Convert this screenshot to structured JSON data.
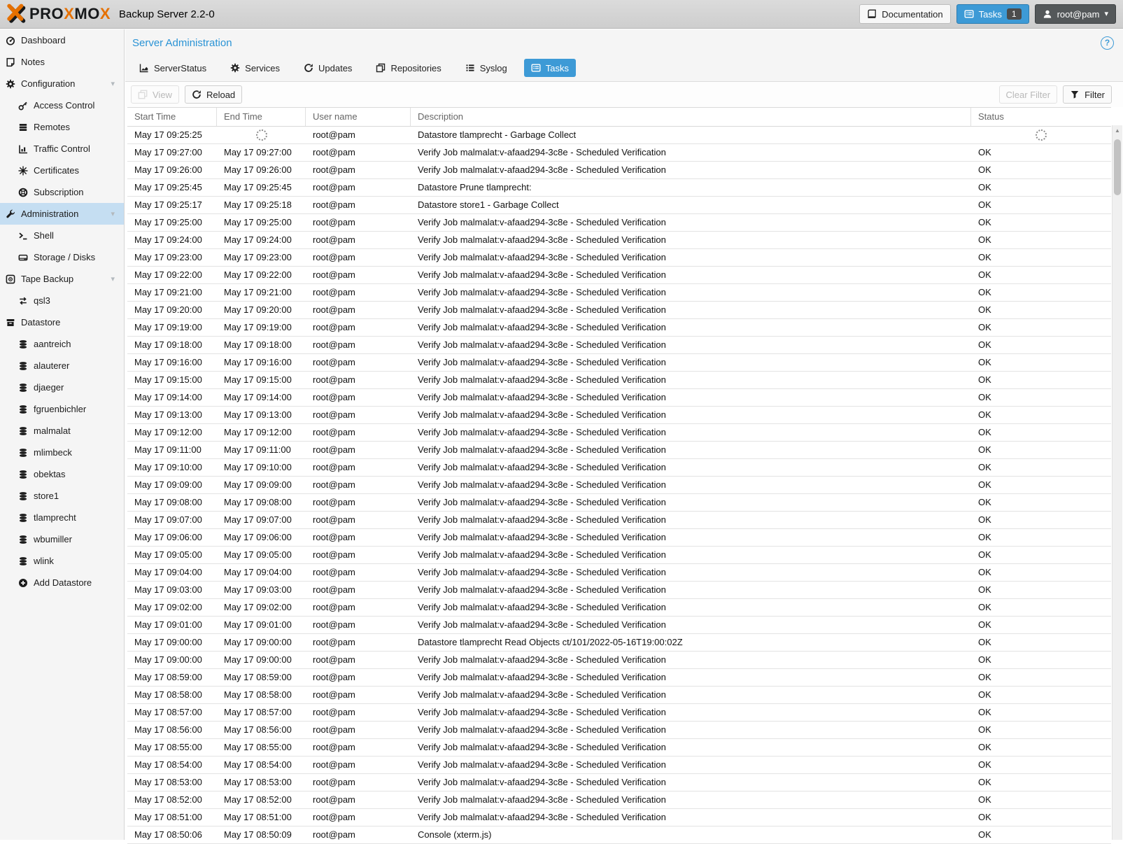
{
  "icons": {
    "caret_down": "▾",
    "help": "?",
    "scroll_up": "▲"
  },
  "topbar": {
    "logo_parts": {
      "p1": "PRO",
      "x1": "X",
      "p2": "MO",
      "x2": "X"
    },
    "product": "Backup Server 2.2-0",
    "documentation_label": "Documentation",
    "tasks_label": "Tasks",
    "tasks_badge": "1",
    "user_label": "root@pam"
  },
  "sidebar": {
    "items": [
      {
        "label": "Dashboard",
        "level": 0
      },
      {
        "label": "Notes",
        "level": 0
      },
      {
        "label": "Configuration",
        "level": 0,
        "caret": true
      },
      {
        "label": "Access Control",
        "level": 1
      },
      {
        "label": "Remotes",
        "level": 1
      },
      {
        "label": "Traffic Control",
        "level": 1
      },
      {
        "label": "Certificates",
        "level": 1
      },
      {
        "label": "Subscription",
        "level": 1
      },
      {
        "label": "Administration",
        "level": 0,
        "caret": true,
        "selected": true
      },
      {
        "label": "Shell",
        "level": 1
      },
      {
        "label": "Storage / Disks",
        "level": 1
      },
      {
        "label": "Tape Backup",
        "level": 0,
        "caret": true
      },
      {
        "label": "qsl3",
        "level": 1
      },
      {
        "label": "Datastore",
        "level": 0
      },
      {
        "label": "aantreich",
        "level": 1
      },
      {
        "label": "alauterer",
        "level": 1
      },
      {
        "label": "djaeger",
        "level": 1
      },
      {
        "label": "fgruenbichler",
        "level": 1
      },
      {
        "label": "malmalat",
        "level": 1
      },
      {
        "label": "mlimbeck",
        "level": 1
      },
      {
        "label": "obektas",
        "level": 1
      },
      {
        "label": "store1",
        "level": 1
      },
      {
        "label": "tlamprecht",
        "level": 1
      },
      {
        "label": "wbumiller",
        "level": 1
      },
      {
        "label": "wlink",
        "level": 1
      },
      {
        "label": "Add Datastore",
        "level": 1
      }
    ]
  },
  "content": {
    "title": "Server Administration",
    "tabs": [
      {
        "label": "ServerStatus"
      },
      {
        "label": "Services"
      },
      {
        "label": "Updates"
      },
      {
        "label": "Repositories"
      },
      {
        "label": "Syslog"
      },
      {
        "label": "Tasks",
        "active": true
      }
    ],
    "toolbar": {
      "view_label": "View",
      "reload_label": "Reload",
      "clear_filter_label": "Clear Filter",
      "filter_label": "Filter"
    },
    "table": {
      "columns": {
        "start": "Start Time",
        "end": "End Time",
        "user": "User name",
        "desc": "Description",
        "status": "Status"
      },
      "rows": [
        {
          "start": "May 17 09:25:25",
          "end": "",
          "user": "root@pam",
          "desc": "Datastore tlamprecht - Garbage Collect",
          "status": "",
          "loading": true
        },
        {
          "start": "May 17 09:27:00",
          "end": "May 17 09:27:00",
          "user": "root@pam",
          "desc": "Verify Job malmalat:v-afaad294-3c8e - Scheduled Verification",
          "status": "OK"
        },
        {
          "start": "May 17 09:26:00",
          "end": "May 17 09:26:00",
          "user": "root@pam",
          "desc": "Verify Job malmalat:v-afaad294-3c8e - Scheduled Verification",
          "status": "OK"
        },
        {
          "start": "May 17 09:25:45",
          "end": "May 17 09:25:45",
          "user": "root@pam",
          "desc": "Datastore Prune tlamprecht:",
          "status": "OK"
        },
        {
          "start": "May 17 09:25:17",
          "end": "May 17 09:25:18",
          "user": "root@pam",
          "desc": "Datastore store1 - Garbage Collect",
          "status": "OK"
        },
        {
          "start": "May 17 09:25:00",
          "end": "May 17 09:25:00",
          "user": "root@pam",
          "desc": "Verify Job malmalat:v-afaad294-3c8e - Scheduled Verification",
          "status": "OK"
        },
        {
          "start": "May 17 09:24:00",
          "end": "May 17 09:24:00",
          "user": "root@pam",
          "desc": "Verify Job malmalat:v-afaad294-3c8e - Scheduled Verification",
          "status": "OK"
        },
        {
          "start": "May 17 09:23:00",
          "end": "May 17 09:23:00",
          "user": "root@pam",
          "desc": "Verify Job malmalat:v-afaad294-3c8e - Scheduled Verification",
          "status": "OK"
        },
        {
          "start": "May 17 09:22:00",
          "end": "May 17 09:22:00",
          "user": "root@pam",
          "desc": "Verify Job malmalat:v-afaad294-3c8e - Scheduled Verification",
          "status": "OK"
        },
        {
          "start": "May 17 09:21:00",
          "end": "May 17 09:21:00",
          "user": "root@pam",
          "desc": "Verify Job malmalat:v-afaad294-3c8e - Scheduled Verification",
          "status": "OK"
        },
        {
          "start": "May 17 09:20:00",
          "end": "May 17 09:20:00",
          "user": "root@pam",
          "desc": "Verify Job malmalat:v-afaad294-3c8e - Scheduled Verification",
          "status": "OK"
        },
        {
          "start": "May 17 09:19:00",
          "end": "May 17 09:19:00",
          "user": "root@pam",
          "desc": "Verify Job malmalat:v-afaad294-3c8e - Scheduled Verification",
          "status": "OK"
        },
        {
          "start": "May 17 09:18:00",
          "end": "May 17 09:18:00",
          "user": "root@pam",
          "desc": "Verify Job malmalat:v-afaad294-3c8e - Scheduled Verification",
          "status": "OK"
        },
        {
          "start": "May 17 09:16:00",
          "end": "May 17 09:16:00",
          "user": "root@pam",
          "desc": "Verify Job malmalat:v-afaad294-3c8e - Scheduled Verification",
          "status": "OK"
        },
        {
          "start": "May 17 09:15:00",
          "end": "May 17 09:15:00",
          "user": "root@pam",
          "desc": "Verify Job malmalat:v-afaad294-3c8e - Scheduled Verification",
          "status": "OK"
        },
        {
          "start": "May 17 09:14:00",
          "end": "May 17 09:14:00",
          "user": "root@pam",
          "desc": "Verify Job malmalat:v-afaad294-3c8e - Scheduled Verification",
          "status": "OK"
        },
        {
          "start": "May 17 09:13:00",
          "end": "May 17 09:13:00",
          "user": "root@pam",
          "desc": "Verify Job malmalat:v-afaad294-3c8e - Scheduled Verification",
          "status": "OK"
        },
        {
          "start": "May 17 09:12:00",
          "end": "May 17 09:12:00",
          "user": "root@pam",
          "desc": "Verify Job malmalat:v-afaad294-3c8e - Scheduled Verification",
          "status": "OK"
        },
        {
          "start": "May 17 09:11:00",
          "end": "May 17 09:11:00",
          "user": "root@pam",
          "desc": "Verify Job malmalat:v-afaad294-3c8e - Scheduled Verification",
          "status": "OK"
        },
        {
          "start": "May 17 09:10:00",
          "end": "May 17 09:10:00",
          "user": "root@pam",
          "desc": "Verify Job malmalat:v-afaad294-3c8e - Scheduled Verification",
          "status": "OK"
        },
        {
          "start": "May 17 09:09:00",
          "end": "May 17 09:09:00",
          "user": "root@pam",
          "desc": "Verify Job malmalat:v-afaad294-3c8e - Scheduled Verification",
          "status": "OK"
        },
        {
          "start": "May 17 09:08:00",
          "end": "May 17 09:08:00",
          "user": "root@pam",
          "desc": "Verify Job malmalat:v-afaad294-3c8e - Scheduled Verification",
          "status": "OK"
        },
        {
          "start": "May 17 09:07:00",
          "end": "May 17 09:07:00",
          "user": "root@pam",
          "desc": "Verify Job malmalat:v-afaad294-3c8e - Scheduled Verification",
          "status": "OK"
        },
        {
          "start": "May 17 09:06:00",
          "end": "May 17 09:06:00",
          "user": "root@pam",
          "desc": "Verify Job malmalat:v-afaad294-3c8e - Scheduled Verification",
          "status": "OK"
        },
        {
          "start": "May 17 09:05:00",
          "end": "May 17 09:05:00",
          "user": "root@pam",
          "desc": "Verify Job malmalat:v-afaad294-3c8e - Scheduled Verification",
          "status": "OK"
        },
        {
          "start": "May 17 09:04:00",
          "end": "May 17 09:04:00",
          "user": "root@pam",
          "desc": "Verify Job malmalat:v-afaad294-3c8e - Scheduled Verification",
          "status": "OK"
        },
        {
          "start": "May 17 09:03:00",
          "end": "May 17 09:03:00",
          "user": "root@pam",
          "desc": "Verify Job malmalat:v-afaad294-3c8e - Scheduled Verification",
          "status": "OK"
        },
        {
          "start": "May 17 09:02:00",
          "end": "May 17 09:02:00",
          "user": "root@pam",
          "desc": "Verify Job malmalat:v-afaad294-3c8e - Scheduled Verification",
          "status": "OK"
        },
        {
          "start": "May 17 09:01:00",
          "end": "May 17 09:01:00",
          "user": "root@pam",
          "desc": "Verify Job malmalat:v-afaad294-3c8e - Scheduled Verification",
          "status": "OK"
        },
        {
          "start": "May 17 09:00:00",
          "end": "May 17 09:00:00",
          "user": "root@pam",
          "desc": "Datastore tlamprecht Read Objects ct/101/2022-05-16T19:00:02Z",
          "status": "OK"
        },
        {
          "start": "May 17 09:00:00",
          "end": "May 17 09:00:00",
          "user": "root@pam",
          "desc": "Verify Job malmalat:v-afaad294-3c8e - Scheduled Verification",
          "status": "OK"
        },
        {
          "start": "May 17 08:59:00",
          "end": "May 17 08:59:00",
          "user": "root@pam",
          "desc": "Verify Job malmalat:v-afaad294-3c8e - Scheduled Verification",
          "status": "OK"
        },
        {
          "start": "May 17 08:58:00",
          "end": "May 17 08:58:00",
          "user": "root@pam",
          "desc": "Verify Job malmalat:v-afaad294-3c8e - Scheduled Verification",
          "status": "OK"
        },
        {
          "start": "May 17 08:57:00",
          "end": "May 17 08:57:00",
          "user": "root@pam",
          "desc": "Verify Job malmalat:v-afaad294-3c8e - Scheduled Verification",
          "status": "OK"
        },
        {
          "start": "May 17 08:56:00",
          "end": "May 17 08:56:00",
          "user": "root@pam",
          "desc": "Verify Job malmalat:v-afaad294-3c8e - Scheduled Verification",
          "status": "OK"
        },
        {
          "start": "May 17 08:55:00",
          "end": "May 17 08:55:00",
          "user": "root@pam",
          "desc": "Verify Job malmalat:v-afaad294-3c8e - Scheduled Verification",
          "status": "OK"
        },
        {
          "start": "May 17 08:54:00",
          "end": "May 17 08:54:00",
          "user": "root@pam",
          "desc": "Verify Job malmalat:v-afaad294-3c8e - Scheduled Verification",
          "status": "OK"
        },
        {
          "start": "May 17 08:53:00",
          "end": "May 17 08:53:00",
          "user": "root@pam",
          "desc": "Verify Job malmalat:v-afaad294-3c8e - Scheduled Verification",
          "status": "OK"
        },
        {
          "start": "May 17 08:52:00",
          "end": "May 17 08:52:00",
          "user": "root@pam",
          "desc": "Verify Job malmalat:v-afaad294-3c8e - Scheduled Verification",
          "status": "OK"
        },
        {
          "start": "May 17 08:51:00",
          "end": "May 17 08:51:00",
          "user": "root@pam",
          "desc": "Verify Job malmalat:v-afaad294-3c8e - Scheduled Verification",
          "status": "OK"
        },
        {
          "start": "May 17 08:50:06",
          "end": "May 17 08:50:09",
          "user": "root@pam",
          "desc": "Console (xterm.js)",
          "status": "OK"
        }
      ]
    }
  },
  "colors": {
    "accent_blue": "#3d9ad6",
    "title_blue": "#2a93d5",
    "selected_item_blue": "#c5def2",
    "brand_orange": "#e57000",
    "topbar_gray": "#d5d5d5"
  }
}
